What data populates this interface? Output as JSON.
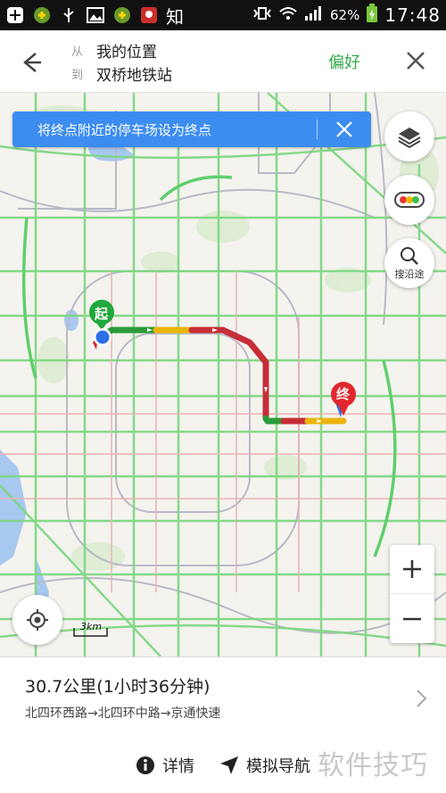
{
  "status_bar": {
    "app_icon_text": "知",
    "battery_percent": "62%",
    "time": "17:48"
  },
  "header": {
    "from_key": "从",
    "from_value": "我的位置",
    "to_key": "到",
    "to_value": "双桥地铁站",
    "preference_label": "偏好"
  },
  "map": {
    "notice_text": "将终点附近的停车场设为终点",
    "start_marker_label": "起",
    "end_marker_label": "终",
    "search_along_label": "搜沿途",
    "scale_label": "3km",
    "colors": {
      "road_clear": "#6cd37a",
      "road_slow": "#f2c31a",
      "road_jam": "#d93a3a",
      "notice_bg": "#3c8df0",
      "start_green": "#21a83c",
      "end_red": "#e3262e"
    }
  },
  "route": {
    "summary": "30.7公里(1小时36分钟)",
    "roads": "北四环西路→北四环中路→京通快速"
  },
  "actions": {
    "details_label": "详情",
    "simulate_label": "模拟导航"
  },
  "watermark": "软件技巧"
}
